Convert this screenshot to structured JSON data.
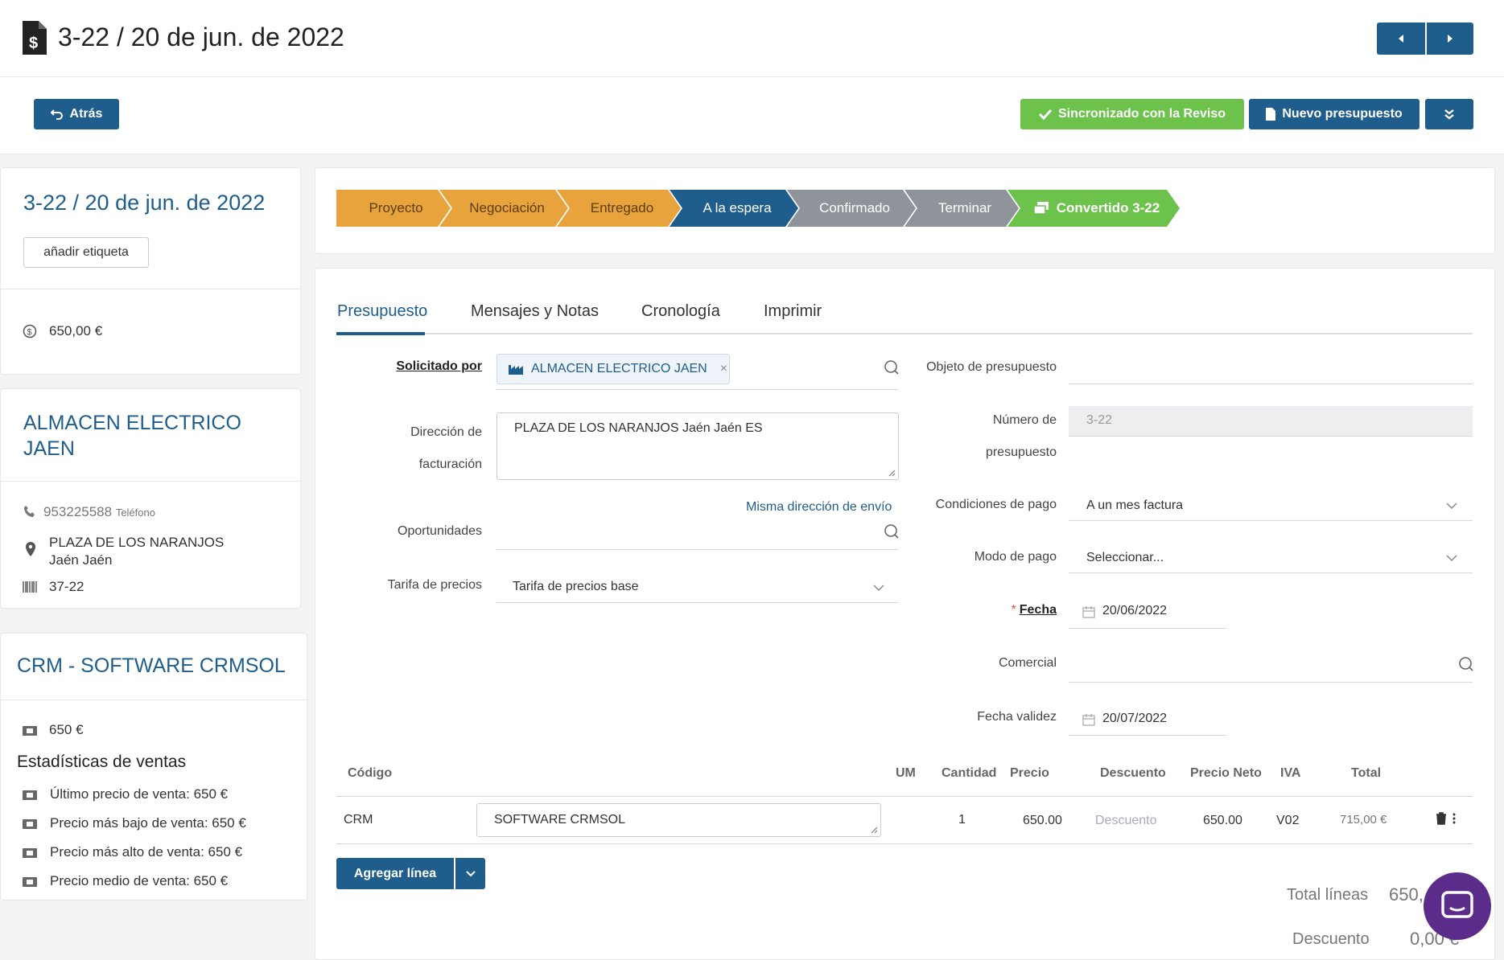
{
  "header": {
    "title": "3-22 / 20 de jun. de 2022"
  },
  "toolbar": {
    "back_label": "Atrás",
    "sync_label": "Sincronizado con la Reviso",
    "new_quote_label": "Nuevo presupuesto"
  },
  "summary": {
    "title": "3-22 / 20 de jun. de 2022",
    "add_tag_label": "añadir etiqueta",
    "amount": "650,00 €"
  },
  "customer": {
    "name_line1": "ALMACEN ELECTRICO",
    "name_line2": "JAEN",
    "phone": "953225588",
    "phone_type": "Teléfono",
    "address_line1": "PLAZA DE LOS NARANJOS",
    "address_line2": "Jaén Jaén",
    "code": "37-22"
  },
  "product": {
    "title": "CRM - SOFTWARE CRMSOL",
    "price": "650 €",
    "stats_heading": "Estadísticas de ventas",
    "stats": [
      "Último precio de venta: 650 €",
      "Precio más bajo de venta: 650 €",
      "Precio más alto de venta: 650 €",
      "Precio medio de venta: 650 €"
    ]
  },
  "pipeline": {
    "stages": [
      "Proyecto",
      "Negociación",
      "Entregado",
      "A la espera",
      "Confirmado",
      "Terminar",
      "Convertido 3-22"
    ]
  },
  "tabs": [
    "Presupuesto",
    "Mensajes y Notas",
    "Cronología",
    "Imprimir"
  ],
  "form": {
    "requested_by_label": "Solicitado por",
    "requested_by_value": "ALMACEN ELECTRICO JAEN",
    "billing_label_1": "Dirección de",
    "billing_label_2": "facturación",
    "billing_value": "PLAZA DE LOS NARANJOS Jaén Jaén  ES",
    "same_address_link": "Misma dirección de envío",
    "opportunities_label": "Oportunidades",
    "price_list_label": "Tarifa de precios",
    "price_list_value": "Tarifa de precios base",
    "object_label": "Objeto de presupuesto",
    "number_label_1": "Número de",
    "number_label_2": "presupuesto",
    "number_value": "3-22",
    "payment_terms_label": "Condiciones de pago",
    "payment_terms_value": "A un mes factura",
    "payment_mode_label": "Modo de pago",
    "payment_mode_value": "Seleccionar...",
    "date_required_mark": "*",
    "date_label": "Fecha",
    "date_value": "20/06/2022",
    "sales_rep_label": "Comercial",
    "validity_label": "Fecha validez",
    "validity_value": "20/07/2022"
  },
  "lines_table": {
    "columns": [
      "Código",
      "UM",
      "Cantidad",
      "Precio",
      "Descuento",
      "Precio Neto",
      "IVA",
      "Total"
    ],
    "rows": [
      {
        "code": "CRM",
        "description": "SOFTWARE CRMSOL",
        "quantity": "1",
        "price": "650.00",
        "discount_placeholder": "Descuento",
        "net_price": "650.00",
        "vat": "V02",
        "total": "715,00 €"
      }
    ],
    "add_line_label": "Agregar línea"
  },
  "totals": {
    "lines_label": "Total líneas",
    "lines_value": "650,",
    "discount_label": "Descuento",
    "discount_value": "0,00 €"
  },
  "colors": {
    "primary": "#1e5d8c",
    "success": "#6cc24a",
    "pipeline_done": "#e8a33d",
    "pipeline_pending": "#8e949a",
    "chat_bubble": "#5b2c8a"
  }
}
